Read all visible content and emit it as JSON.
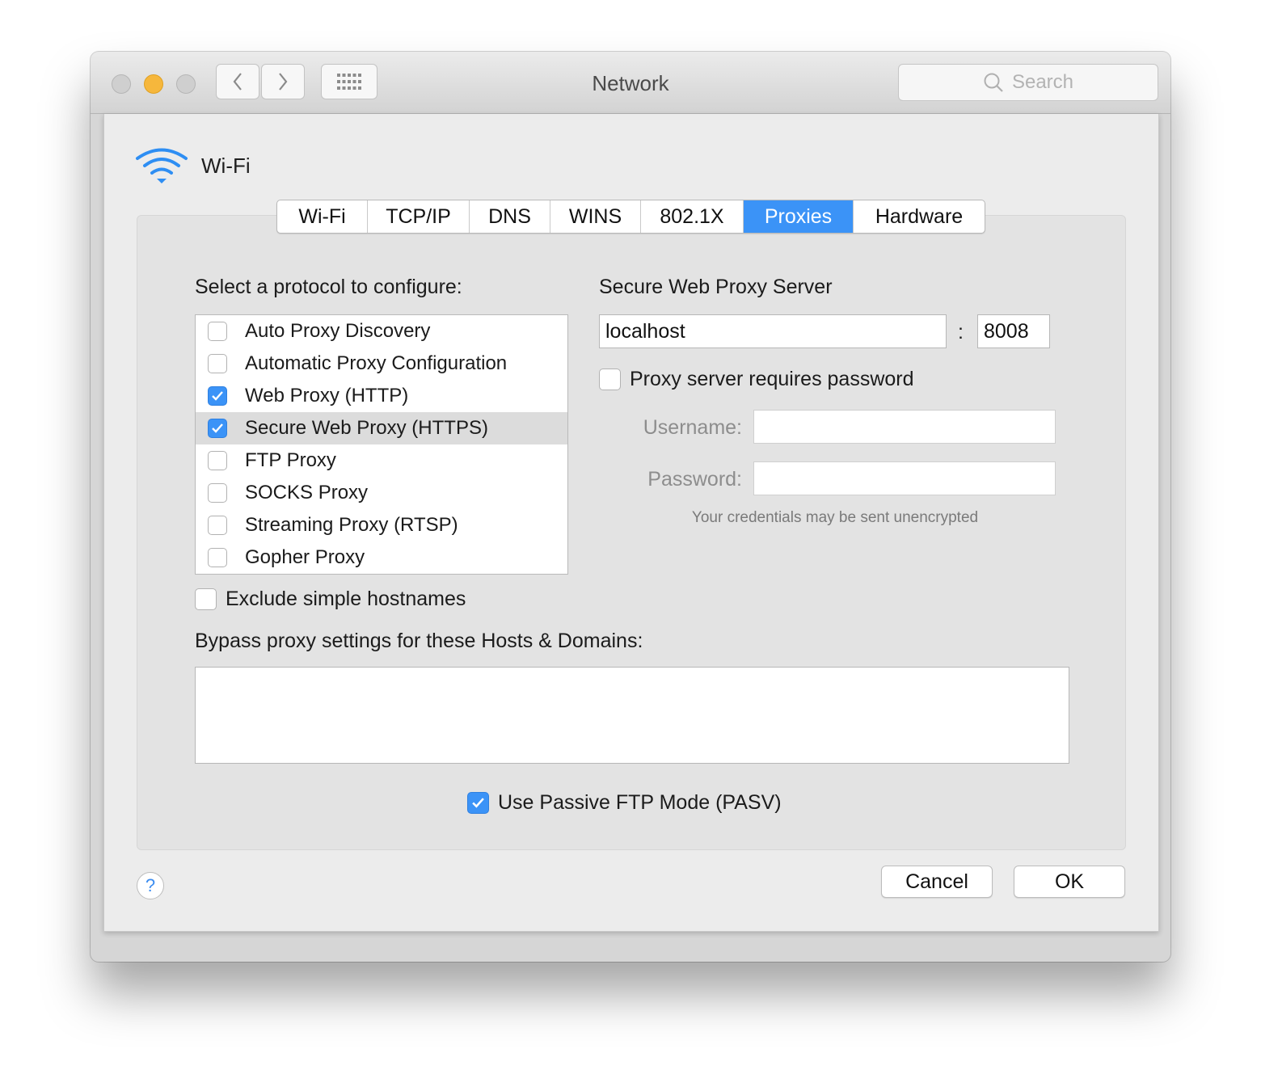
{
  "window": {
    "title": "Network"
  },
  "toolbar": {
    "search_placeholder": "Search"
  },
  "service": {
    "name": "Wi-Fi"
  },
  "tabs": [
    {
      "label": "Wi-Fi"
    },
    {
      "label": "TCP/IP"
    },
    {
      "label": "DNS"
    },
    {
      "label": "WINS"
    },
    {
      "label": "802.1X"
    },
    {
      "label": "Proxies",
      "active": true
    },
    {
      "label": "Hardware"
    }
  ],
  "proxies": {
    "protocol_heading": "Select a protocol to configure:",
    "protocols": [
      {
        "label": "Auto Proxy Discovery",
        "checked": false
      },
      {
        "label": "Automatic Proxy Configuration",
        "checked": false
      },
      {
        "label": "Web Proxy (HTTP)",
        "checked": true
      },
      {
        "label": "Secure Web Proxy (HTTPS)",
        "checked": true,
        "selected": true
      },
      {
        "label": "FTP Proxy",
        "checked": false
      },
      {
        "label": "SOCKS Proxy",
        "checked": false
      },
      {
        "label": "Streaming Proxy (RTSP)",
        "checked": false
      },
      {
        "label": "Gopher Proxy",
        "checked": false
      }
    ],
    "server_heading": "Secure Web Proxy Server",
    "server_host": "localhost",
    "colon": ":",
    "server_port": "8008",
    "requires_password_label": "Proxy server requires password",
    "requires_password": false,
    "username_label": "Username:",
    "username_value": "",
    "password_label": "Password:",
    "password_value": "",
    "credentials_note": "Your credentials may be sent unencrypted",
    "exclude_simple_label": "Exclude simple hostnames",
    "exclude_simple": false,
    "bypass_heading": "Bypass proxy settings for these Hosts & Domains:",
    "bypass_value": "",
    "passive_ftp_label": "Use Passive FTP Mode (PASV)",
    "passive_ftp": true
  },
  "buttons": {
    "help": "?",
    "cancel": "Cancel",
    "ok": "OK"
  },
  "colors": {
    "accent": "#3b93f7",
    "minimize": "#f6b73c"
  }
}
